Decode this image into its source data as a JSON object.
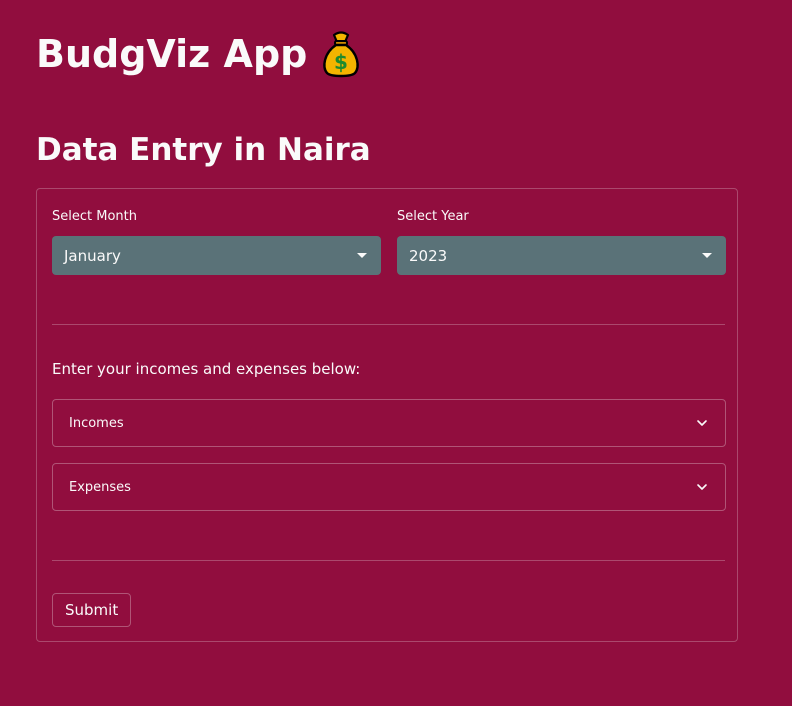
{
  "header": {
    "app_title": "BudgViz App",
    "app_icon": "money-bag-icon"
  },
  "section": {
    "title": "Data Entry in Naira"
  },
  "form": {
    "month": {
      "label": "Select Month",
      "value": "January"
    },
    "year": {
      "label": "Select Year",
      "value": "2023"
    },
    "instructions": "Enter your incomes and expenses below:",
    "expanders": [
      {
        "label": "Incomes"
      },
      {
        "label": "Expenses"
      }
    ],
    "submit_label": "Submit"
  },
  "colors": {
    "background": "#910d3e",
    "select_background": "#5a7278",
    "text": "#fafafa"
  }
}
